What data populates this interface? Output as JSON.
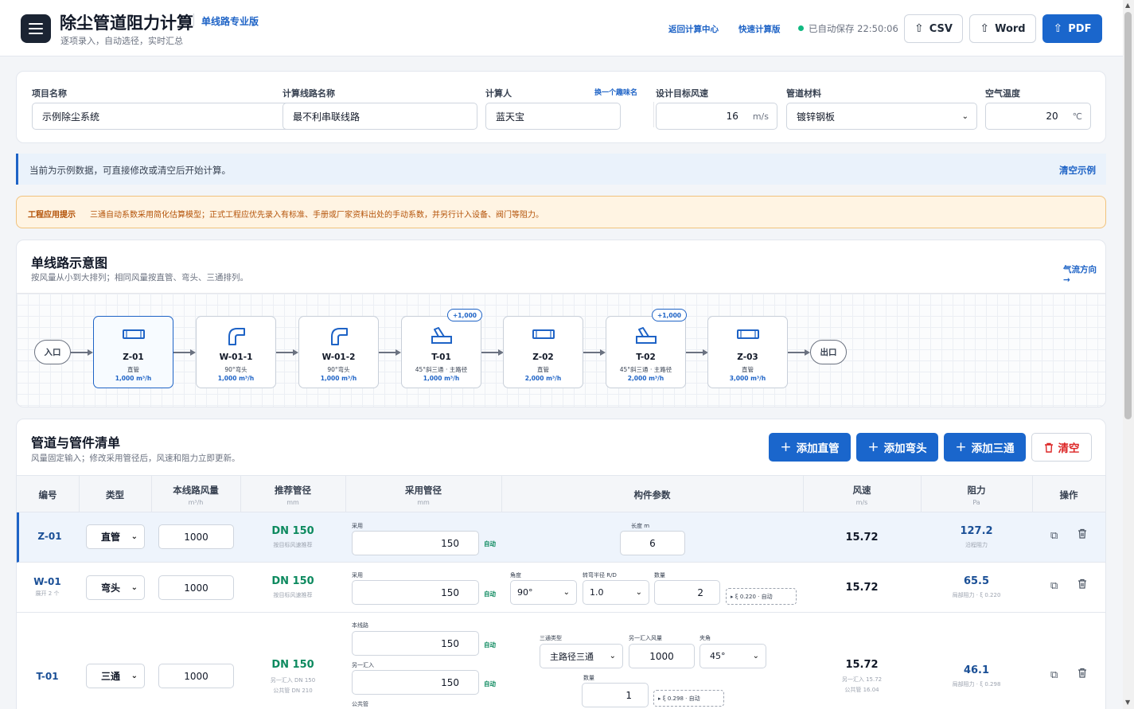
{
  "header": {
    "title": "除尘管道阻力计算",
    "edition": "单线路专业版",
    "subtitle": "逐项录入，自动选径，实时汇总",
    "links": [
      "返回计算中心",
      "快速计算版"
    ],
    "save_status": "已自动保存 22:50:06",
    "buttons": {
      "csv": "CSV",
      "word": "Word",
      "pdf": "PDF"
    }
  },
  "project": {
    "name_label": "项目名称",
    "name_value": "示例除尘系统",
    "route_label": "计算线路名称",
    "route_value": "最不利串联线路",
    "calc_label": "计算人",
    "calc_value": "蓝天宝",
    "rename_link": "换一个趣味名",
    "speed_label": "设计目标风速",
    "speed_value": "16",
    "speed_unit": "m/s",
    "material_label": "管道材料",
    "material_value": "镀锌钢板",
    "temp_label": "空气温度",
    "temp_value": "20",
    "temp_unit": "℃"
  },
  "notice": {
    "text": "当前为示例数据，可直接修改或清空后开始计算。",
    "link": "清空示例"
  },
  "warning": {
    "tag": "工程应用提示",
    "text": "三通自动系数采用简化估算模型；正式工程应优先录入有标准、手册或厂家资料出处的手动系数，并另行计入设备、阀门等阻力。"
  },
  "diagram": {
    "title": "单线路示意图",
    "subtitle": "按风量从小到大排列；相同风量按直管、弯头、三通排列。",
    "flow_link": "气流方向 →",
    "inlet": "入口",
    "outlet": "出口",
    "nodes": [
      {
        "id": "Z-01",
        "type": "直管",
        "flow": "1,000 m³/h",
        "icon": "duct-icon",
        "badge": ""
      },
      {
        "id": "W-01-1",
        "type": "90°弯头",
        "flow": "1,000 m³/h",
        "icon": "elbow-icon",
        "badge": ""
      },
      {
        "id": "W-01-2",
        "type": "90°弯头",
        "flow": "1,000 m³/h",
        "icon": "elbow-icon",
        "badge": ""
      },
      {
        "id": "T-01",
        "type": "45°斜三通 · 主路径",
        "flow": "1,000 m³/h",
        "icon": "tee-icon",
        "badge": "+1,000"
      },
      {
        "id": "Z-02",
        "type": "直管",
        "flow": "2,000 m³/h",
        "icon": "duct-icon",
        "badge": ""
      },
      {
        "id": "T-02",
        "type": "45°斜三通 · 主路径",
        "flow": "2,000 m³/h",
        "icon": "tee-icon",
        "badge": "+1,000"
      },
      {
        "id": "Z-03",
        "type": "直管",
        "flow": "3,000 m³/h",
        "icon": "duct-icon",
        "badge": ""
      }
    ]
  },
  "table": {
    "title": "管道与管件清单",
    "subtitle": "风量固定输入；修改采用管径后，风速和阻力立即更新。",
    "buttons": {
      "add_duct": "添加直管",
      "add_elbow": "添加弯头",
      "add_tee": "添加三通",
      "clear": "清空"
    },
    "headers": {
      "id": "编号",
      "type": "类型",
      "flow": "本线路风量",
      "flow_unit": "m³/h",
      "rec": "推荐管径",
      "rec_unit": "mm",
      "used": "采用管径",
      "used_unit": "mm",
      "params": "构件参数",
      "vel": "风速",
      "vel_unit": "m/s",
      "res": "阻力",
      "res_unit": "Pa",
      "ops": "操作"
    },
    "rows": [
      {
        "id": "Z-01",
        "id_sub": "",
        "type": "直管",
        "flow": "1000",
        "rec": "DN 150",
        "rec_sub": "按目标风速推荐",
        "used_label": "采用",
        "used": "150",
        "auto": "自动",
        "length_label": "长度 m",
        "length": "6",
        "vel": "15.72",
        "res": "127.2",
        "res_sub": "沿程阻力"
      },
      {
        "id": "W-01",
        "id_sub": "展开 2 个",
        "type": "弯头",
        "flow": "1000",
        "rec": "DN 150",
        "rec_sub": "按目标风速推荐",
        "used_label": "采用",
        "used": "150",
        "auto": "自动",
        "angle_label": "角度",
        "angle": "90°",
        "radius_label": "转弯半径 R/D",
        "radius": "1.0",
        "count_label": "数量",
        "count": "2",
        "xi": "▸ ξ 0.220 · 自动",
        "vel": "15.72",
        "res": "65.5",
        "res_sub": "局部阻力 · ξ 0.220"
      },
      {
        "id": "T-01",
        "id_sub": "",
        "type": "三通",
        "flow": "1000",
        "rec": "DN 150",
        "rec_sub1": "另一汇入 DN 150",
        "rec_sub2": "公共管 DN 210",
        "line_label": "本线路",
        "line_value": "150",
        "other_label": "另一汇入",
        "other_value": "150",
        "common_label": "公共管",
        "auto": "自动",
        "tee_type_label": "三通类型",
        "tee_type": "主路径三通",
        "other_flow_label": "另一汇入风量",
        "other_flow": "1000",
        "angle_label": "夹角",
        "angle": "45°",
        "count_label": "数量",
        "count": "1",
        "xi": "▸ ξ 0.298 · 自动",
        "vel": "15.72",
        "vel_sub1": "另一汇入 15.72",
        "vel_sub2": "公共管 16.04",
        "res": "46.1",
        "res_sub": "局部阻力 · ξ 0.298"
      }
    ]
  }
}
